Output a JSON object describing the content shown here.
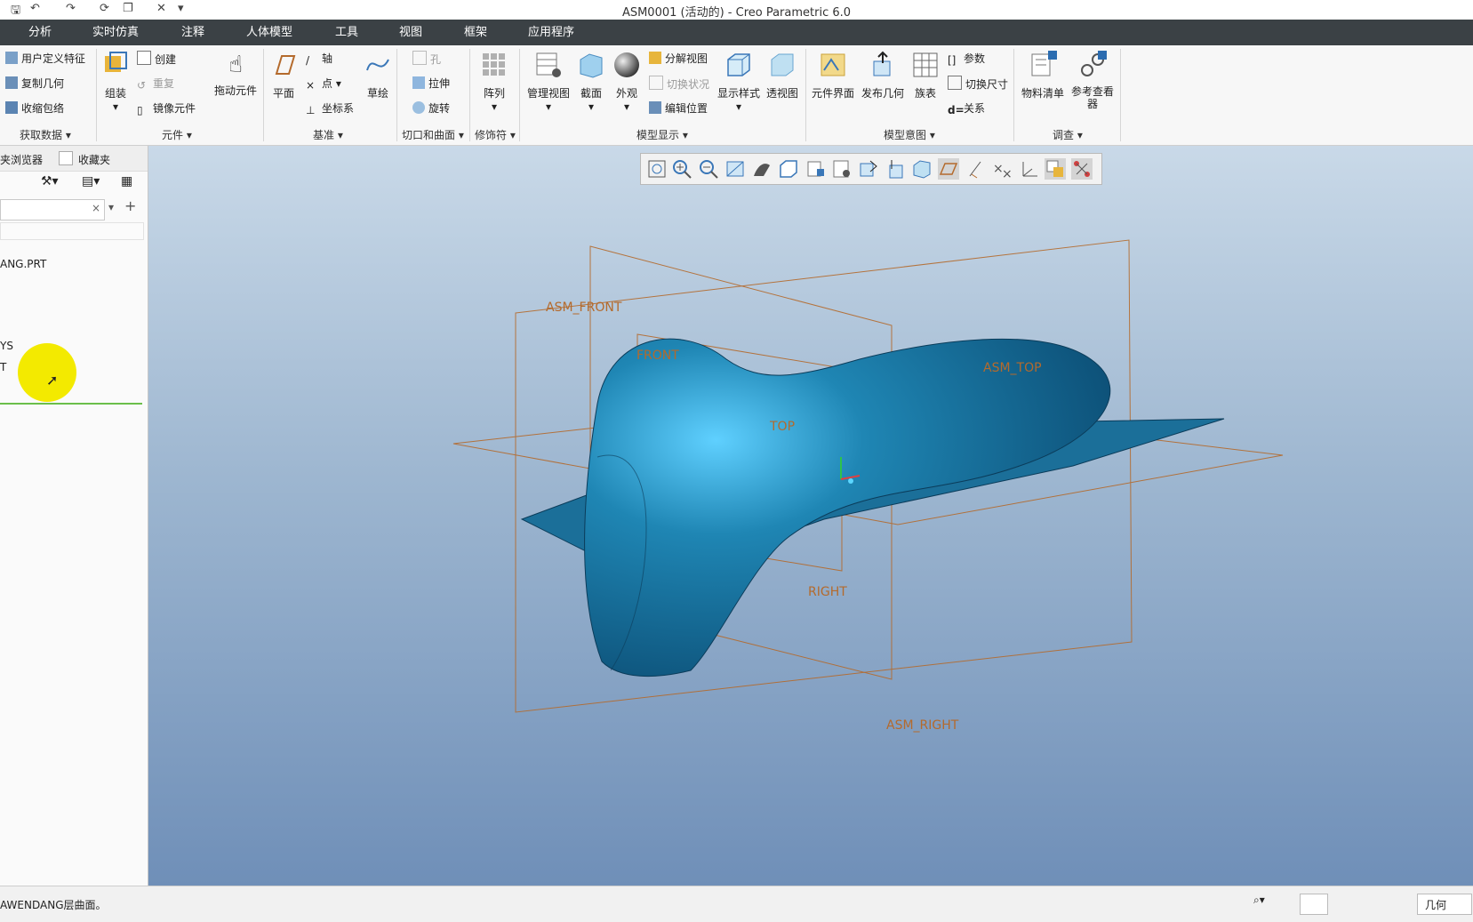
{
  "window": {
    "title": "ASM0001 (活动的) - Creo Parametric 6.0"
  },
  "menu_tabs": [
    "分析",
    "实时仿真",
    "注释",
    "人体模型",
    "工具",
    "视图",
    "框架",
    "应用程序"
  ],
  "ribbon": {
    "get_data": {
      "items": [
        "用户定义特征",
        "复制几何",
        "收缩包络"
      ],
      "label": "获取数据"
    },
    "component": {
      "assemble": "组装",
      "create": "创建",
      "repeat": "重复",
      "mirror": "镜像元件",
      "drag": "拖动元件",
      "label": "元件"
    },
    "datum": {
      "plane": "平面",
      "axis": "轴",
      "point": "点",
      "csys": "坐标系",
      "sketch": "草绘",
      "label": "基准"
    },
    "cut_surface": {
      "hole": "孔",
      "extrude": "拉伸",
      "revolve": "旋转",
      "label": "切口和曲面"
    },
    "modifiers": {
      "pattern": "阵列",
      "label": "修饰符"
    },
    "model_display": {
      "manage_views": "管理视图",
      "section": "截面",
      "appearance": "外观",
      "exploded": "分解视图",
      "toggle_status": "切换状况",
      "edit_position": "编辑位置",
      "display_style": "显示样式",
      "perspective": "透视图",
      "label": "模型显示"
    },
    "model_intent": {
      "component_interface": "元件界面",
      "publish_geometry": "发布几何",
      "family_table": "族表",
      "parameters": "参数",
      "switch_dims": "切换尺寸",
      "relations": "关系",
      "label": "模型意图"
    },
    "investigate": {
      "bom": "物料清单",
      "reference_viewer": "参考查看器",
      "label": "调查"
    }
  },
  "left_panel": {
    "tabs": [
      "夹浏览器",
      "收藏夹"
    ],
    "tree_items": [
      "ANG.PRT",
      "YS",
      "T"
    ]
  },
  "viewport": {
    "datum_labels": [
      "ASM_FRONT",
      "FRONT",
      "TOP",
      "ASM_TOP",
      "RIGHT",
      "ASM_RIGHT"
    ],
    "colors": {
      "model": "#1c7aa6",
      "datum": "#b46a2c",
      "bg_top": "#c9d9e8",
      "bg_bottom": "#6f8fb8"
    }
  },
  "status": {
    "message": "AWENDANG层曲面。",
    "filter": "几何"
  }
}
